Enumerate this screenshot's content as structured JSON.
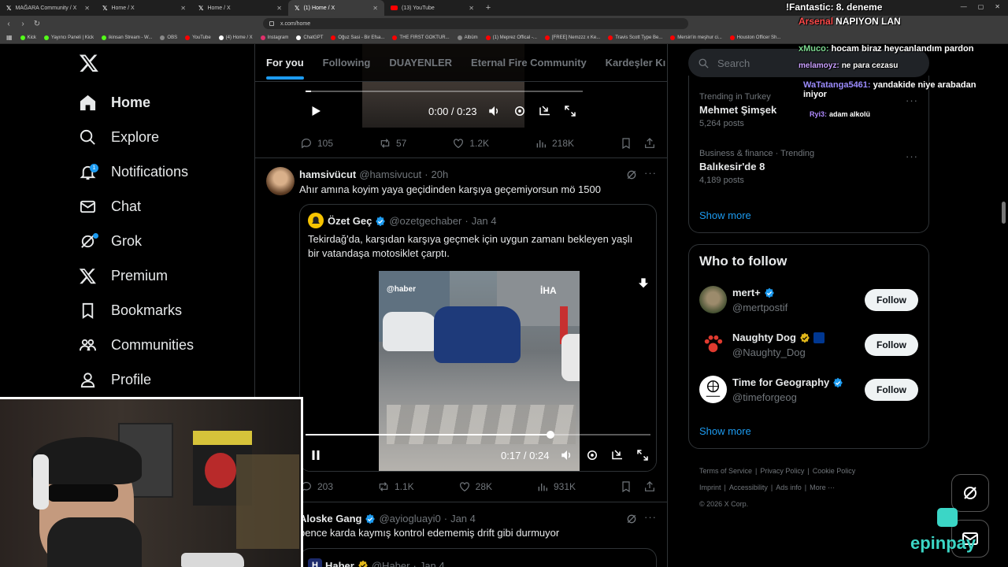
{
  "browser": {
    "tabs": [
      {
        "label": "MAĞARA Community / X",
        "icon": "x-icon"
      },
      {
        "label": "Home / X",
        "icon": "x-icon"
      },
      {
        "label": "Home / X",
        "icon": "x-icon"
      },
      {
        "label": "(1) Home / X",
        "icon": "x-icon",
        "active": true
      },
      {
        "label": "(13) YouTube",
        "icon": "youtube-icon"
      }
    ],
    "url": "x.com/home",
    "bookmarks": [
      {
        "label": "Kick",
        "color": "#53fc18"
      },
      {
        "label": "Yayıncı Paneli | Kick",
        "color": "#53fc18"
      },
      {
        "label": "ikinsan Stream - W...",
        "color": "#53fc18"
      },
      {
        "label": "OBS",
        "color": "#888888"
      },
      {
        "label": "YouTube",
        "color": "#ff0000"
      },
      {
        "label": "(4) Home / X",
        "color": "#ffffff"
      },
      {
        "label": "Instagram",
        "color": "#e1306c"
      },
      {
        "label": "ChatGPT",
        "color": "#ffffff"
      },
      {
        "label": "Oğuz Sasi - Bir Efsa...",
        "color": "#ff0000"
      },
      {
        "label": "THE FIRST GOKTUR...",
        "color": "#ff0000"
      },
      {
        "label": "Albüm",
        "color": "#888888"
      },
      {
        "label": "(1) Meprez Offical -...",
        "color": "#ff0000"
      },
      {
        "label": "[FREE] Nemzzz x Ke...",
        "color": "#ff0000"
      },
      {
        "label": "Travis Scott Type Be...",
        "color": "#ff0000"
      },
      {
        "label": "Mersin'in meşhur ci...",
        "color": "#ff0000"
      },
      {
        "label": "Houston Officer Sh...",
        "color": "#ff0000"
      }
    ]
  },
  "nav": {
    "items": [
      {
        "label": "Home",
        "icon": "home-icon"
      },
      {
        "label": "Explore",
        "icon": "search-icon"
      },
      {
        "label": "Notifications",
        "icon": "bell-icon",
        "badge": "1"
      },
      {
        "label": "Chat",
        "icon": "mail-icon"
      },
      {
        "label": "Grok",
        "icon": "grok-icon"
      },
      {
        "label": "Premium",
        "icon": "x-logo-icon"
      },
      {
        "label": "Bookmarks",
        "icon": "bookmark-icon"
      },
      {
        "label": "Communities",
        "icon": "communities-icon"
      },
      {
        "label": "Profile",
        "icon": "person-icon"
      }
    ]
  },
  "feed": {
    "tabs": [
      "For you",
      "Following",
      "DUAYENLER",
      "Eternal Fire Community",
      "Kardeşler Kı"
    ],
    "tweet1": {
      "video_time": "0:00 / 0:23",
      "stats": {
        "replies": "105",
        "reposts": "57",
        "likes": "1.2K",
        "views": "218K"
      }
    },
    "tweet2": {
      "name": "hamsivücut",
      "handle": "@hamsivucut",
      "time": "20h",
      "text": "Ahır amına koyim yaya geçidinden karşıya geçemiyorsun mö 1500",
      "quote": {
        "name": "Özet Geç",
        "handle": "@ozetgechaber",
        "time": "Jan 4",
        "text": "Tekirdağ'da, karşıdan karşıya geçmek için uygun zamanı bekleyen yaşlı bir vatandaşa motosiklet çarptı.",
        "video_watermark_left": "@haber",
        "video_watermark_right": "İHA",
        "video_time": "0:17 / 0:24",
        "progress": 0.71
      },
      "stats": {
        "replies": "203",
        "reposts": "1.1K",
        "likes": "28K",
        "views": "931K"
      }
    },
    "tweet3": {
      "name": "Aloske Gang",
      "handle": "@ayiogluayi0",
      "time": "Jan 4",
      "text": "bence karda kaymış kontrol edememiş drift gibi durmuyor",
      "quote_name": "Haber",
      "quote_handle": "@Haber",
      "quote_time": "Jan 4"
    }
  },
  "sidebar": {
    "search_placeholder": "Search",
    "trends": [
      {
        "context": "Trending in Turkey",
        "title": "Mehmet Şimşek",
        "count": "5,264 posts"
      },
      {
        "context": "Business & finance · Trending",
        "title": "Balıkesir'de 8",
        "count": "4,189 posts"
      }
    ],
    "trends_show_more": "Show more",
    "who_to_follow": {
      "title": "Who to follow",
      "accounts": [
        {
          "name": "mert+",
          "handle": "@mertpostif",
          "button": "Follow"
        },
        {
          "name": "Naughty Dog",
          "handle": "@Naughty_Dog",
          "button": "Follow"
        },
        {
          "name": "Time for Geography",
          "handle": "@timeforgeog",
          "button": "Follow"
        }
      ],
      "show_more": "Show more"
    },
    "footer": {
      "links": [
        "Terms of Service",
        "Privacy Policy",
        "Cookie Policy",
        "Imprint",
        "Accessibility",
        "Ads info",
        "More ···"
      ],
      "copyright": "© 2026 X Corp."
    }
  },
  "stream_chat": [
    {
      "user": "!Fantastic:",
      "msg": "8. deneme",
      "color": "#ffffff"
    },
    {
      "user": "Arsenal",
      "msg": "NAPIYON LAN",
      "color": "#ff4a4a"
    },
    {
      "user": "",
      "msg": "hocam biraz heycanlandım pardon",
      "color": "#ffffff"
    },
    {
      "user": "xMuco:",
      "msg": "hocam biraz heycanlandım pardon",
      "color": "#7bd88f"
    },
    {
      "user": "melamoyz:",
      "msg": "ne para cezasu",
      "color": "#c9a0ff"
    },
    {
      "user": "WaTatanga5461:",
      "msg": "yandakide niye arabadan iniyor",
      "color": "#9c8cff"
    },
    {
      "user": "Ryi3:",
      "msg": "adam alkolü",
      "color": "#b08aff"
    }
  ],
  "overlay": {
    "brand": "epinpay"
  },
  "colors": {
    "accent": "#1d9bf0",
    "background": "#000000",
    "border": "#2f3336",
    "muted": "#71767b"
  }
}
